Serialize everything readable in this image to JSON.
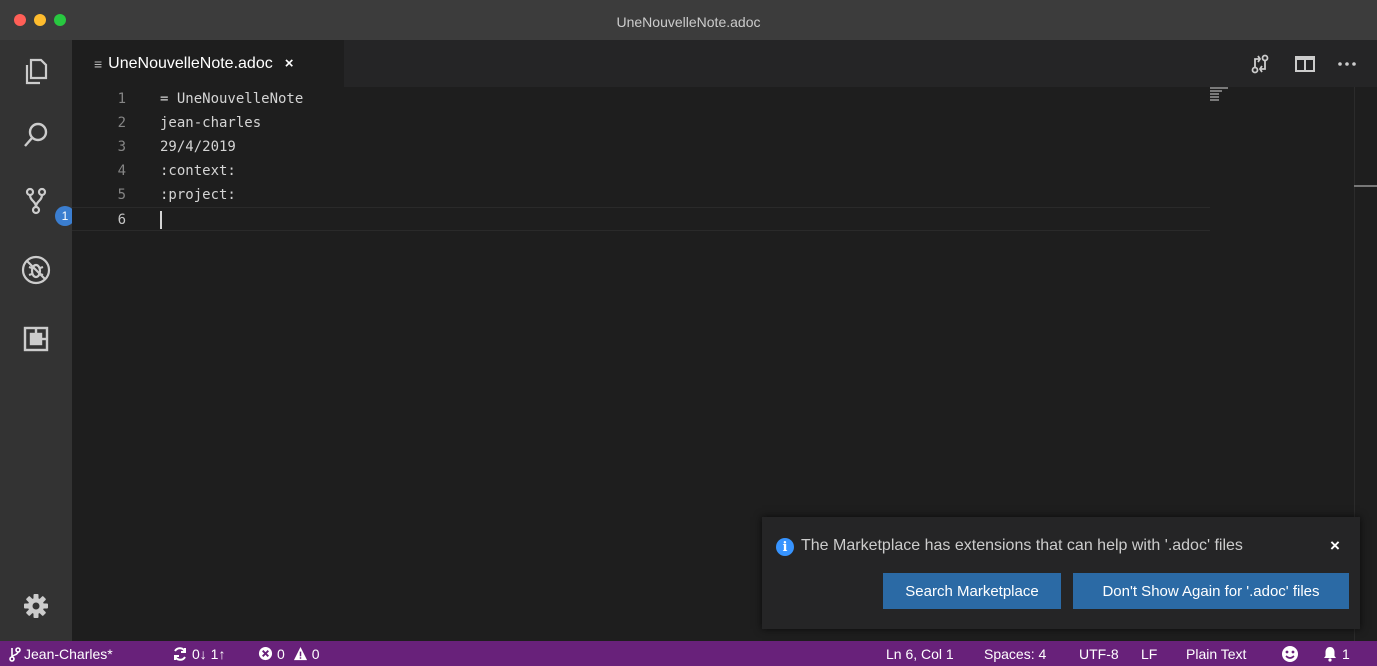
{
  "window": {
    "title": "UneNouvelleNote.adoc"
  },
  "activity_bar": {
    "scm_badge": "1"
  },
  "tab": {
    "filename": "UneNouvelleNote.adoc",
    "file_icon": "≡",
    "close": "×"
  },
  "editor": {
    "lines": [
      {
        "num": "1",
        "text": "= UneNouvelleNote"
      },
      {
        "num": "2",
        "text": "jean-charles"
      },
      {
        "num": "3",
        "text": "29/4/2019"
      },
      {
        "num": "4",
        "text": ":context:"
      },
      {
        "num": "5",
        "text": ":project:"
      },
      {
        "num": "6",
        "text": ""
      }
    ]
  },
  "notification": {
    "message": "The Marketplace has extensions that can help with '.adoc' files",
    "info_icon": "i",
    "close": "×",
    "buttons": {
      "search": "Search Marketplace",
      "dont_show": "Don't Show Again for '.adoc' files"
    }
  },
  "status_bar": {
    "branch": "Jean-Charles*",
    "sync": "0↓ 1↑",
    "errors": "0",
    "warnings": "0",
    "position": "Ln 6, Col 1",
    "spaces": "Spaces: 4",
    "encoding": "UTF-8",
    "eol": "LF",
    "language": "Plain Text",
    "notifications_count": "1"
  },
  "colors": {
    "status_bar": "#68217a",
    "activity_bar": "#333333",
    "editor_bg": "#1e1e1e",
    "button": "#2b6aa5",
    "badge": "#3b7ed0"
  }
}
